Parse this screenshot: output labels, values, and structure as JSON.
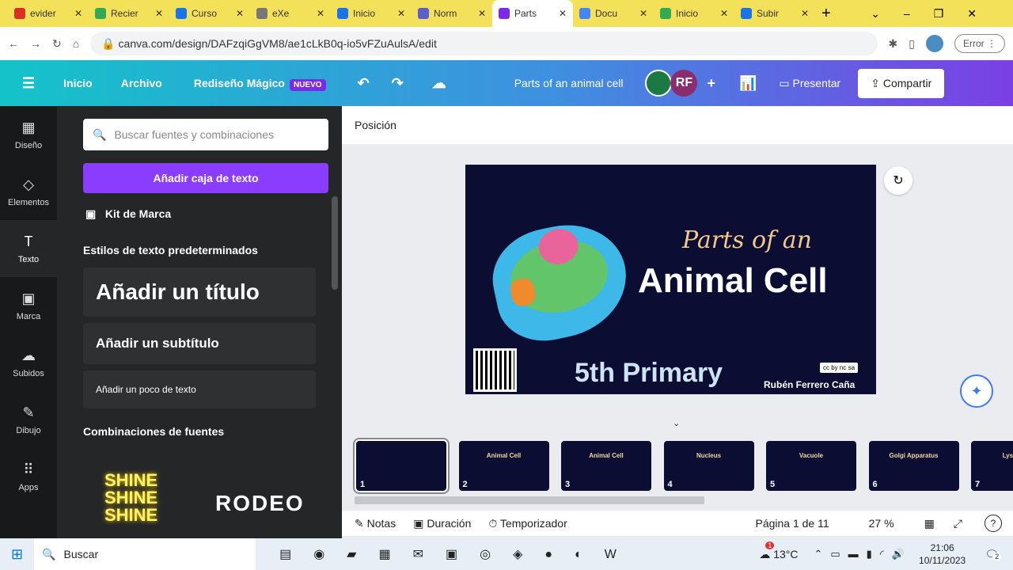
{
  "browser": {
    "tabs": [
      {
        "label": "evider",
        "color": "#d93025"
      },
      {
        "label": "Recier",
        "color": "#34a853"
      },
      {
        "label": "Curso",
        "color": "#1a73e8"
      },
      {
        "label": "eXe",
        "color": "#777"
      },
      {
        "label": "Inicio",
        "color": "#1a73e8"
      },
      {
        "label": "Norm",
        "color": "#5b5fc7"
      },
      {
        "label": "Parts",
        "color": "#7d2ae8"
      },
      {
        "label": "Docu",
        "color": "#4285f4"
      },
      {
        "label": "Inicio",
        "color": "#34a853"
      },
      {
        "label": "Subir",
        "color": "#1a73e8"
      }
    ],
    "active_tab": 6,
    "url": "canva.com/design/DAFzqiGgVM8/ae1cLkB0q-io5vFZuAulsA/edit",
    "profile_status": "Error"
  },
  "header": {
    "home": "Inicio",
    "file": "Archivo",
    "magic": "Rediseño Mágico",
    "new_badge": "NUEVO",
    "title": "Parts of an animal cell",
    "avatar": "RF",
    "present": "Presentar",
    "share": "Compartir"
  },
  "leftnav": [
    {
      "icon": "▦",
      "label": "Diseño"
    },
    {
      "icon": "◇",
      "label": "Elementos"
    },
    {
      "icon": "T",
      "label": "Texto"
    },
    {
      "icon": "▣",
      "label": "Marca"
    },
    {
      "icon": "☁",
      "label": "Subidos"
    },
    {
      "icon": "✎",
      "label": "Dibujo"
    },
    {
      "icon": "⠿",
      "label": "Apps"
    }
  ],
  "panel": {
    "search_placeholder": "Buscar fuentes y combinaciones",
    "add_textbox": "Añadir caja de texto",
    "brand_kit": "Kit de Marca",
    "default_styles": "Estilos de texto predeterminados",
    "add_title": "Añadir un título",
    "add_subtitle": "Añadir un subtítulo",
    "add_body": "Añadir un poco de texto",
    "combos": "Combinaciones de fuentes",
    "combo1": "SHINE",
    "combo2": "RODEO"
  },
  "canvas": {
    "position": "Posición",
    "slide": {
      "script_title": "Parts of an",
      "title": "Animal Cell",
      "subtitle": "5th Primary",
      "author": "Rubén Ferrero Caña",
      "license": "cc by nc sa"
    }
  },
  "thumbnails": [
    {
      "n": "1",
      "title": ""
    },
    {
      "n": "2",
      "title": "Animal Cell"
    },
    {
      "n": "3",
      "title": "Animal Cell"
    },
    {
      "n": "4",
      "title": "Nucleus"
    },
    {
      "n": "5",
      "title": "Vacuole"
    },
    {
      "n": "6",
      "title": "Golgi Apparatus"
    },
    {
      "n": "7",
      "title": "Lysosom"
    }
  ],
  "bottombar": {
    "notes": "Notas",
    "duration": "Duración",
    "timer": "Temporizador",
    "page": "Página 1 de 11",
    "zoom": "27 %"
  },
  "taskbar": {
    "search": "Buscar",
    "temp": "13°C",
    "time": "21:06",
    "date": "10/11/2023",
    "weather_badge": "1",
    "notif": "2"
  }
}
